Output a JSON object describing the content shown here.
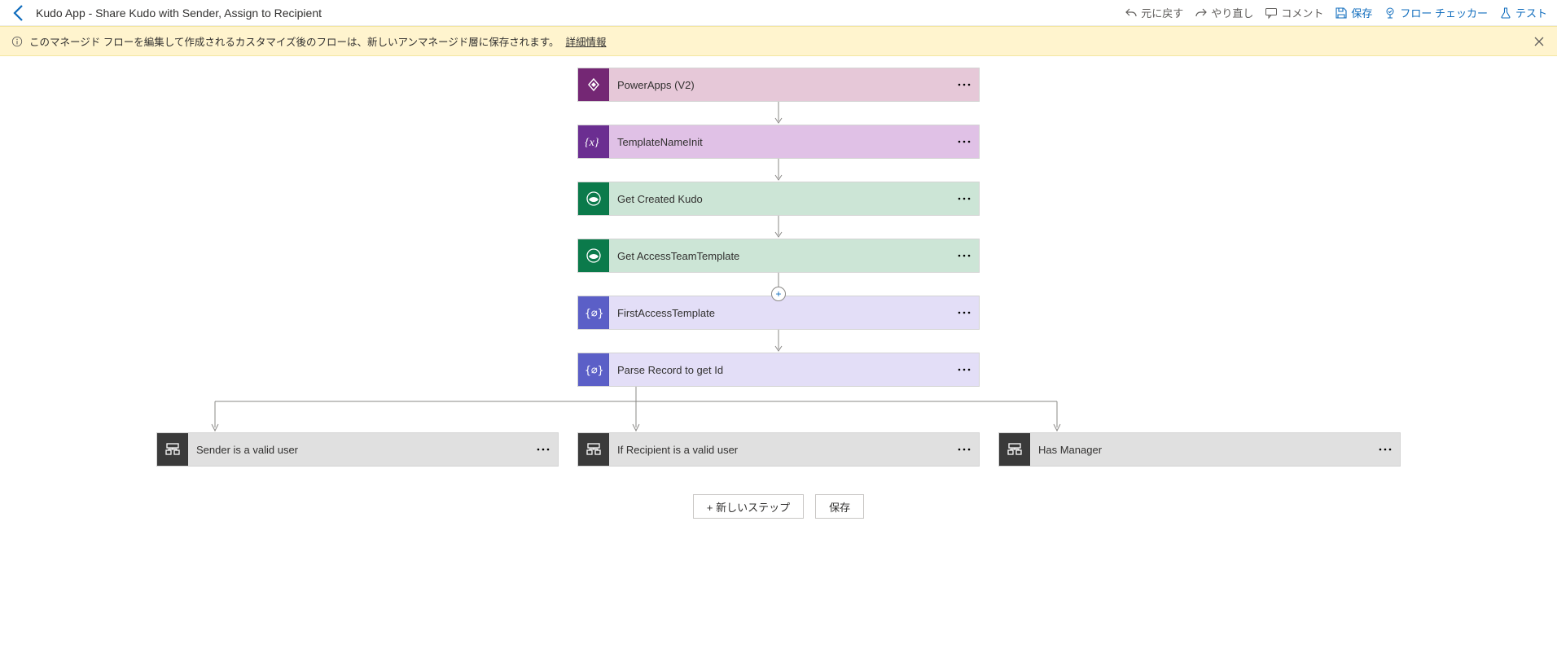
{
  "toolbar": {
    "title": "Kudo App - Share Kudo with Sender, Assign to Recipient",
    "undo": "元に戻す",
    "redo": "やり直し",
    "comment": "コメント",
    "save": "保存",
    "flowChecker": "フロー チェッカー",
    "test": "テスト"
  },
  "banner": {
    "text": "このマネージド フローを編集して作成されるカスタマイズ後のフローは、新しいアンマネージド層に保存されます。",
    "link": "詳細情報"
  },
  "steps": [
    {
      "label": "PowerApps (V2)",
      "class": "c-pa",
      "icon": "powerapps"
    },
    {
      "label": "TemplateNameInit",
      "class": "c-var",
      "icon": "variable"
    },
    {
      "label": "Get Created Kudo",
      "class": "c-dv",
      "icon": "dataverse"
    },
    {
      "label": "Get AccessTeamTemplate",
      "class": "c-dv",
      "icon": "dataverse"
    },
    {
      "label": "FirstAccessTemplate",
      "class": "c-compose",
      "icon": "compose"
    },
    {
      "label": "Parse Record to get Id",
      "class": "c-compose",
      "icon": "compose"
    }
  ],
  "branches": [
    {
      "label": "Sender is a valid user",
      "class": "c-scope",
      "icon": "scope"
    },
    {
      "label": "If Recipient is a valid user",
      "class": "c-scope",
      "icon": "scope"
    },
    {
      "label": "Has Manager",
      "class": "c-scope",
      "icon": "scope"
    }
  ],
  "footer": {
    "newStep": "+ 新しいステップ",
    "save": "保存"
  }
}
